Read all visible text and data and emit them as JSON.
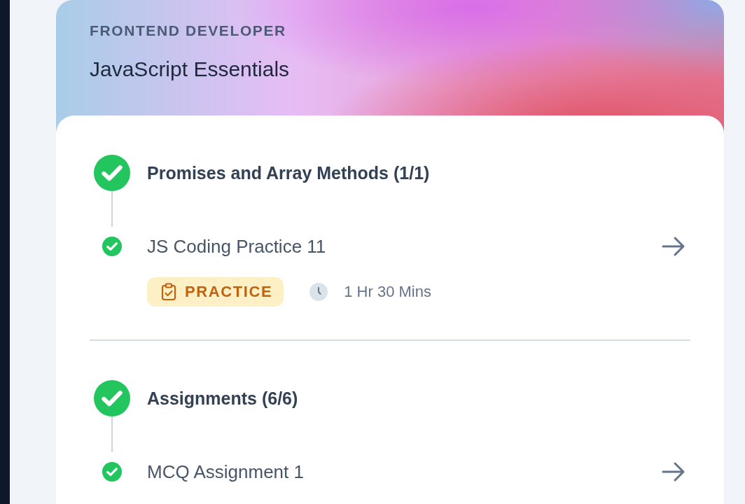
{
  "course": {
    "track": "FRONTEND DEVELOPER",
    "title": "JavaScript Essentials"
  },
  "sections": [
    {
      "title": "Promises and Array Methods (1/1)",
      "completed": true,
      "items": [
        {
          "title": "JS Coding Practice 11",
          "completed": true,
          "tag": {
            "label": "PRACTICE"
          },
          "duration": "1 Hr 30 Mins"
        }
      ]
    },
    {
      "title": "Assignments (6/6)",
      "completed": true,
      "items": [
        {
          "title": "MCQ Assignment 1",
          "completed": true
        }
      ]
    }
  ]
}
